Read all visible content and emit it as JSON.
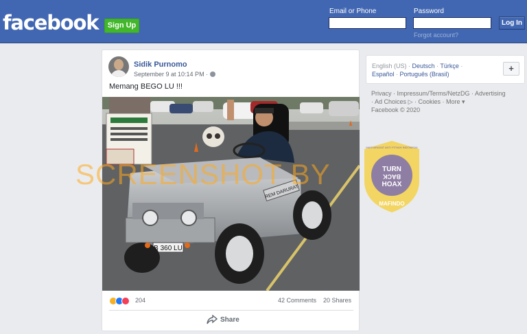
{
  "header": {
    "logo": "facebook",
    "signup_label": "Sign Up",
    "email_label": "Email or Phone",
    "password_label": "Password",
    "login_label": "Log In",
    "forgot_label": "Forgot account?"
  },
  "post": {
    "author": "Sidik Purnomo",
    "timestamp": "September 9 at 10:14 PM ·",
    "message": "Memang BEGO LU !!!",
    "plate_text": "B 360 LU",
    "hood_text": "REM DARURAT",
    "reaction_count": "204",
    "comments": "42 Comments",
    "shares": "20 Shares",
    "share_label": "Share"
  },
  "sidebar": {
    "languages": [
      "English (US)",
      "Deutsch",
      "Türkçe",
      "Español",
      "Português (Brasil)"
    ],
    "plus_label": "+",
    "footer_links": [
      "Privacy",
      "Impressum/Terms/NetzDG",
      "Advertising",
      "Ad Choices",
      "Cookies",
      "More"
    ],
    "copyright": "Facebook © 2020"
  },
  "overlay": {
    "watermark": "SCREENSHOT BY",
    "badge_line1": "TURN",
    "badge_line2": "BACK",
    "badge_line3": "HOAX",
    "badge_ring": "MASYARAKAT ANTI FITNAH INDONESIA",
    "badge_name": "MAFINDO"
  },
  "colors": {
    "brand": "#4267b2",
    "signup": "#42b72a",
    "link": "#385898",
    "badge": "#f4d03f"
  }
}
